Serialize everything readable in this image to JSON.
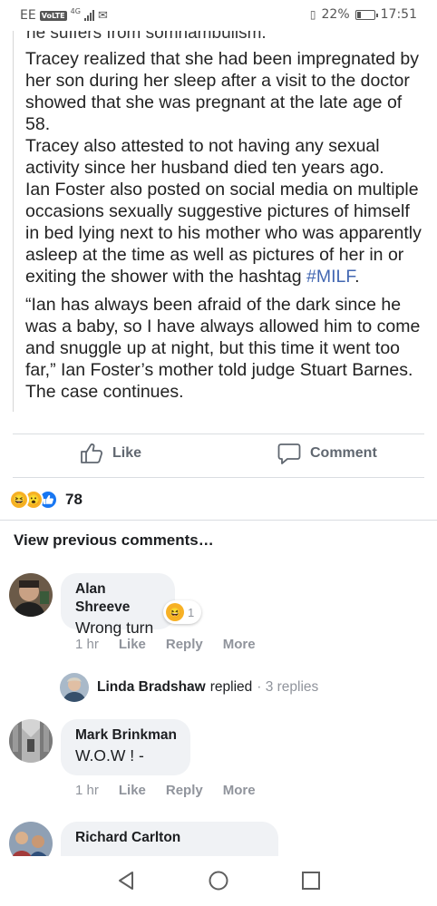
{
  "status_bar": {
    "carrier": "EE",
    "volte": "VoLTE",
    "network": "4G",
    "battery_text": "22%",
    "battery_level": 0.22,
    "time": "17:51",
    "icons": [
      "signal-icon",
      "mail-icon",
      "vibrate-icon",
      "battery-icon"
    ]
  },
  "article": {
    "cut_line": "he suffers from somnambulism.",
    "paragraphs": [
      "Tracey realized that she had been impregnated by her son during her sleep after a visit to the doctor showed that she was pregnant at the late age of 58.",
      "Tracey also attested to not having any sexual activity since her husband died ten years ago.",
      "Ian Foster also posted on social media on multiple occasions sexually suggestive pictures of himself in bed lying next to his mother who was apparently asleep at the time as well as pictures of her in or exiting the shower with the hashtag ",
      "“Ian has always been afraid of the dark since he was a baby, so I have always allowed him to come and snuggle up at night, but this time it went too far,” Ian Foster’s mother told judge Stuart Barnes. The case continues."
    ],
    "hashtag": "#MILF",
    "hashtag_suffix": "."
  },
  "actions": {
    "like_label": "Like",
    "comment_label": "Comment"
  },
  "reactions": {
    "count": "78",
    "types": [
      "haha",
      "wow",
      "like"
    ]
  },
  "comments_section": {
    "view_previous": "View previous comments…",
    "meta_like": "Like",
    "meta_reply": "Reply",
    "meta_more": "More",
    "comments": [
      {
        "name": "Alan Shreeve",
        "text": "Wrong turn",
        "time": "1 hr",
        "reaction_count": "1"
      },
      {
        "name": "Mark Brinkman",
        "text": "W.O.W ! -",
        "time": "1 hr"
      },
      {
        "name": "Richard Carlton"
      }
    ],
    "reply_summary": {
      "name": "Linda Bradshaw",
      "verb": "replied",
      "count_text": "· 3 replies"
    }
  },
  "colors": {
    "link": "#4267b2",
    "muted": "#90949c",
    "bubble": "#f0f2f5",
    "like_blue": "#1877f2",
    "emoji_yellow": "#f7b125"
  }
}
